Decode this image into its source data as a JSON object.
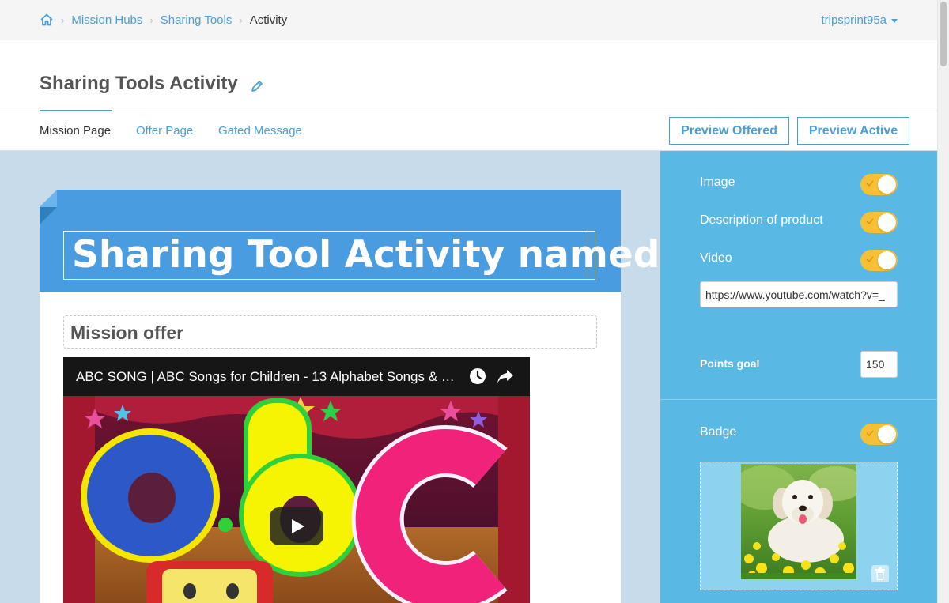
{
  "breadcrumb": {
    "home_icon": "home-icon",
    "items": [
      {
        "label": "Mission Hubs"
      },
      {
        "label": "Sharing Tools"
      }
    ],
    "current": "Activity"
  },
  "user": {
    "name": "tripsprint95a"
  },
  "page": {
    "title": "Sharing Tools Activity",
    "edit_icon": "pencil-icon"
  },
  "tabs": [
    {
      "label": "Mission Page",
      "active": true
    },
    {
      "label": "Offer Page",
      "active": false
    },
    {
      "label": "Gated Message",
      "active": false
    }
  ],
  "preview": {
    "offered_label": "Preview Offered",
    "active_label": "Preview Active"
  },
  "card": {
    "header_title": "Sharing Tool Activity named",
    "offer_title": "Mission offer",
    "video": {
      "title": "ABC SONG | ABC Songs for Children - 13 Alphabet Songs & …",
      "watch_later_icon": "clock-icon",
      "share_icon": "share-icon",
      "play_icon": "play-icon"
    }
  },
  "options": {
    "image": {
      "label": "Image",
      "enabled": true
    },
    "description": {
      "label": "Description of product",
      "enabled": true
    },
    "video": {
      "label": "Video",
      "enabled": true,
      "url": "https://www.youtube.com/watch?v=_"
    },
    "points_goal": {
      "label": "Points goal",
      "value": "150"
    },
    "badge": {
      "label": "Badge",
      "enabled": true,
      "delete_icon": "trash-icon"
    }
  },
  "colors": {
    "accent": "#4a9fd8",
    "header_blue": "#4a9ce0",
    "panel_blue": "#5ab9e4",
    "toggle_on": "#f7c034",
    "canvas_bg": "#c7dbea"
  }
}
